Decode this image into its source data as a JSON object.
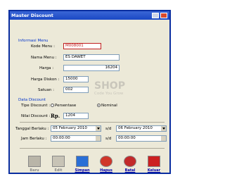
{
  "window": {
    "title": "Master Discount"
  },
  "info_section": {
    "label": "Informasi Menu"
  },
  "fields": {
    "kode_menu": {
      "label": "Kode Menu :",
      "value": "M008001"
    },
    "nama_menu": {
      "label": "Nama Menu :",
      "value": "ES DAWET"
    },
    "harga": {
      "label": "Harga :",
      "value": "16204"
    },
    "harga_diskon": {
      "label": "Harga Diskon :",
      "value": "15000"
    },
    "satuan": {
      "label": "Satuan :",
      "value": "002"
    }
  },
  "discount_section": {
    "label": "Data Discount",
    "tipe_label": "Tipe Discount :",
    "option_persentase": "Persentase",
    "option_nominal": "Nominal",
    "nilai_label": "Nilai Discount :",
    "currency": "Rp.",
    "nilai_value": "1204"
  },
  "dates": {
    "tanggal_label": "Tanggal Berlaku :",
    "from_date": "05  February  2010",
    "sd": "s/d",
    "to_date": "06  February  2010",
    "jam_label": "Jam Berlaku :",
    "from_time": "00:00:00",
    "to_time": "00:00:00"
  },
  "watermark": {
    "text": "SHOP",
    "slogan": "Code You Grow"
  },
  "buttons": {
    "baru": "Baru",
    "edit": "Edit",
    "simpan": "Simpan",
    "hapus": "Hapus",
    "batal": "Batal",
    "keluar": "Keluar"
  },
  "colors": {
    "title_bar": "#1a48c4",
    "section_label": "#0033cc",
    "active_button_label": "#0000aa"
  }
}
